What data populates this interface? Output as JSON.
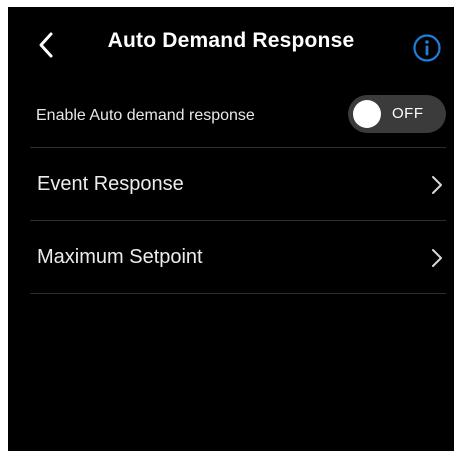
{
  "header": {
    "title": "Auto Demand Response",
    "back_icon": "chevron-left-icon",
    "info_icon": "info-icon"
  },
  "enable_row": {
    "label": "Enable Auto demand response",
    "toggle_state": "OFF"
  },
  "menu": [
    {
      "label": "Event Response",
      "icon": "chevron-right-icon"
    },
    {
      "label": "Maximum Setpoint",
      "icon": "chevron-right-icon"
    }
  ],
  "colors": {
    "background": "#000000",
    "text": "#ffffff",
    "accent": "#1e7fd6",
    "toggle_off": "#3b3b3b",
    "divider": "#2e2e2e"
  }
}
